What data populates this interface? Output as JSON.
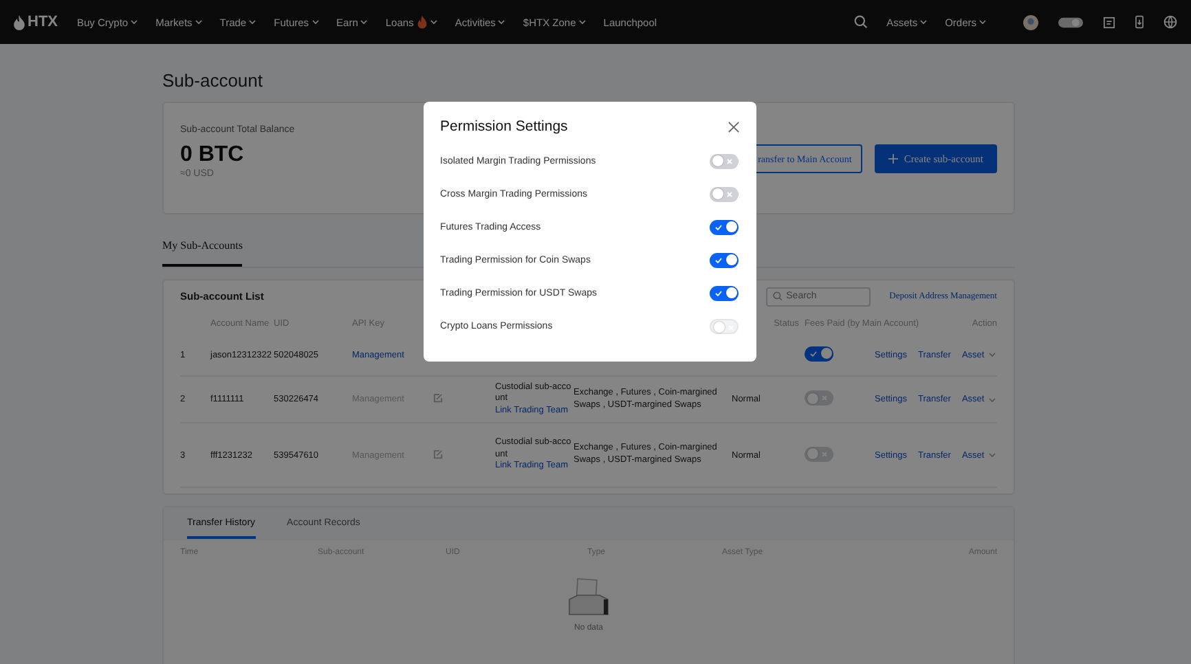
{
  "nav": {
    "logo": "HTX",
    "items": [
      {
        "label": "Buy Crypto",
        "dropdown": true,
        "fire": false
      },
      {
        "label": "Markets",
        "dropdown": true,
        "fire": false
      },
      {
        "label": "Trade",
        "dropdown": true,
        "fire": false
      },
      {
        "label": "Futures",
        "dropdown": true,
        "fire": false
      },
      {
        "label": "Earn",
        "dropdown": true,
        "fire": false
      },
      {
        "label": "Loans",
        "dropdown": true,
        "fire": true
      },
      {
        "label": "Activities",
        "dropdown": true,
        "fire": false
      },
      {
        "label": "$HTX Zone",
        "dropdown": true,
        "fire": false
      },
      {
        "label": "Launchpool",
        "dropdown": false,
        "fire": false
      }
    ],
    "right_items": [
      {
        "label": "Assets"
      },
      {
        "label": "Orders"
      }
    ]
  },
  "page_title": "Sub-account",
  "balance": {
    "label": "Sub-account Total Balance",
    "amount": "0 BTC",
    "fiat": "≈0 USD",
    "transfer_button": "ransfer to Main Account",
    "create_button": "Create sub-account"
  },
  "section_tabs": [
    {
      "label": "My Sub-Accounts",
      "selected": true
    }
  ],
  "list": {
    "title": "Sub-account List",
    "search_placeholder": "Search",
    "deposit_link": "Deposit Address Management",
    "columns": [
      "Account Name",
      "UID",
      "API Key",
      "Status",
      "Fees Paid (by Main Account)",
      "Action"
    ],
    "rows": [
      {
        "index": "1",
        "name": "jason12312322",
        "uid": "502048025",
        "api_key": "Management",
        "api_active": true,
        "edit": false,
        "type": "",
        "link": "",
        "permissions": "",
        "status": "",
        "fees_paid_on": true,
        "actions": [
          "Settings",
          "Transfer",
          "Asset"
        ]
      },
      {
        "index": "2",
        "name": "f1111111",
        "uid": "530226474",
        "api_key": "Management",
        "api_active": false,
        "edit": true,
        "type": "Custodial sub-account",
        "link": "Link Trading Team",
        "permissions": "Exchange , Futures , Coin-margined Swaps , USDT-margined Swaps",
        "status": "Normal",
        "fees_paid_on": false,
        "actions": [
          "Settings",
          "Transfer",
          "Asset"
        ]
      },
      {
        "index": "3",
        "name": "fff1231232",
        "uid": "539547610",
        "api_key": "Management",
        "api_active": false,
        "edit": true,
        "type": "Custodial sub-account",
        "link": "Link Trading Team",
        "permissions": "Exchange , Futures , Coin-margined Swaps , USDT-margined Swaps",
        "status": "Normal",
        "fees_paid_on": false,
        "actions": [
          "Settings",
          "Transfer",
          "Asset"
        ]
      }
    ]
  },
  "history": {
    "tabs": [
      {
        "label": "Transfer History",
        "selected": true
      },
      {
        "label": "Account Records",
        "selected": false
      }
    ],
    "columns": [
      "Time",
      "Sub-account",
      "UID",
      "Type",
      "Asset Type",
      "Amount"
    ],
    "empty_text": "No data"
  },
  "modal": {
    "title": "Permission Settings",
    "permissions": [
      {
        "label": "Isolated Margin Trading Permissions",
        "on": false,
        "disabled": false
      },
      {
        "label": "Cross Margin Trading Permissions",
        "on": false,
        "disabled": false
      },
      {
        "label": "Futures Trading Access",
        "on": true,
        "disabled": false
      },
      {
        "label": "Trading Permission for Coin Swaps",
        "on": true,
        "disabled": false
      },
      {
        "label": "Trading Permission for USDT Swaps",
        "on": true,
        "disabled": false
      },
      {
        "label": "Crypto Loans Permissions",
        "on": false,
        "disabled": true
      }
    ]
  }
}
